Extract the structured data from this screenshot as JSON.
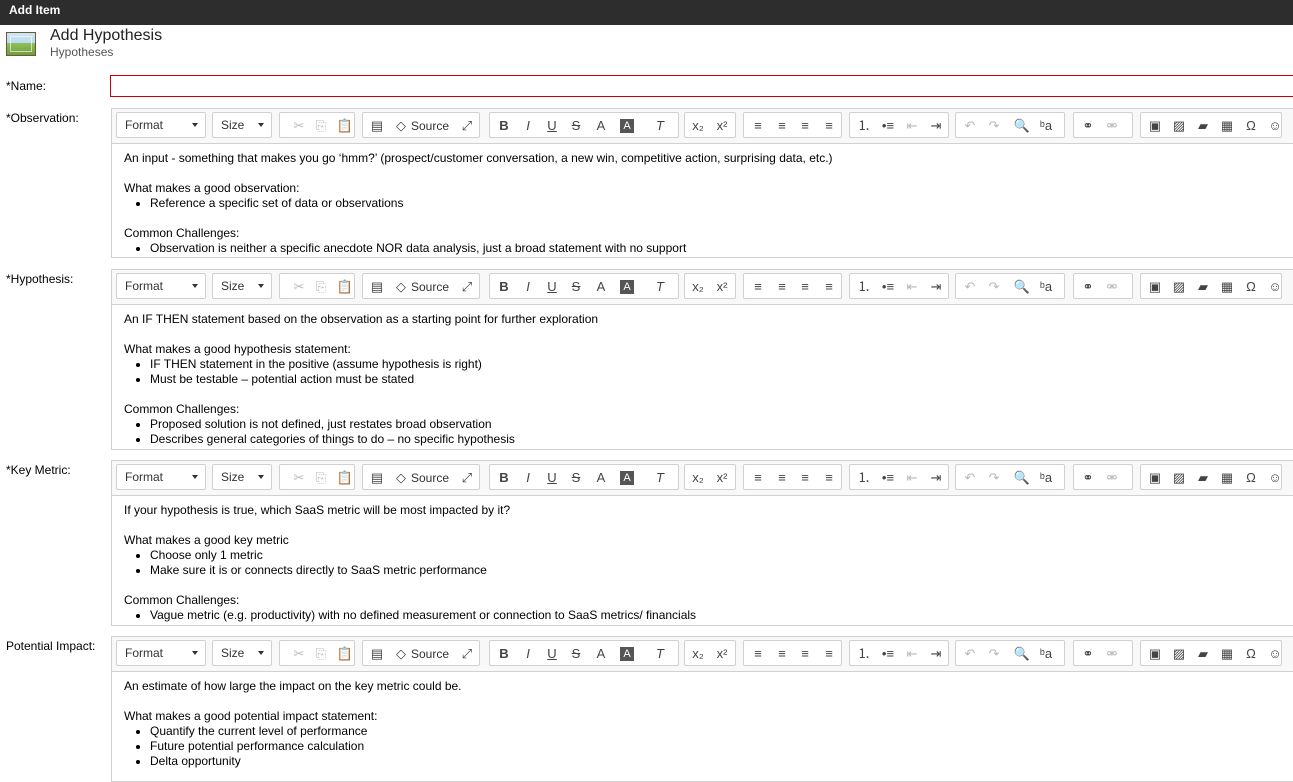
{
  "window": {
    "title": "Add Item"
  },
  "header": {
    "title": "Add Hypothesis",
    "subtitle": "Hypotheses",
    "icon": "image-icon"
  },
  "name_field": {
    "label": "*Name:",
    "value": ""
  },
  "toolbar": {
    "format": "Format",
    "size": "Size",
    "source": "Source",
    "icons": {
      "cut": "✂",
      "copy": "⎘",
      "paste": "📋",
      "document": "▤",
      "source": "◇",
      "maximize": "⤢",
      "bold": "B",
      "italic": "I",
      "underline": "U",
      "strike": "S",
      "text_color": "A",
      "bg_color": "A",
      "remove_format": "T",
      "subscript": "x₂",
      "superscript": "x²",
      "align_left": "≡",
      "align_center": "≡",
      "align_right": "≡",
      "justify": "≡",
      "numbered_list": "⒈",
      "bulleted_list": "•≡",
      "outdent": "⇤",
      "indent": "⇥",
      "undo": "↶",
      "redo": "↷",
      "find": "🔍",
      "replace": "ᵇa",
      "link": "⚭",
      "unlink": "⚮",
      "image_insert": "▣",
      "image_manager": "▨",
      "folder": "▰",
      "table": "▦",
      "omega": "Ω",
      "accessibility": "☺"
    }
  },
  "fields": [
    {
      "label": "*Observation:",
      "intro": "An input - something that makes you go ‘hmm?’  (prospect/customer conversation, a new win, competitive action, surprising data, etc.)",
      "good_heading": "What makes a good observation:",
      "good_items": [
        "Reference a specific set of data or observations"
      ],
      "challenges_heading": "Common Challenges:",
      "challenge_items": [
        "Observation is neither a specific anecdote NOR data analysis, just a broad statement with no support"
      ]
    },
    {
      "label": "*Hypothesis:",
      "intro": "An IF THEN statement based on the observation as a starting point for further exploration",
      "good_heading": "What makes a good hypothesis statement:",
      "good_items": [
        "IF THEN statement in the positive (assume hypothesis is right)",
        "Must be testable – potential action must be stated"
      ],
      "challenges_heading": "Common Challenges:",
      "challenge_items": [
        "Proposed solution is not defined, just restates broad observation",
        "Describes general categories of things to do – no specific hypothesis"
      ]
    },
    {
      "label": "*Key Metric:",
      "intro": "If your hypothesis is true, which SaaS metric will be most impacted by it?",
      "good_heading": "What makes a good key metric",
      "good_items": [
        "Choose only 1 metric",
        "Make sure it is or  connects directly to SaaS metric performance"
      ],
      "challenges_heading": "Common Challenges:",
      "challenge_items": [
        "Vague metric (e.g. productivity) with no defined measurement or connection to SaaS metrics/ financials"
      ]
    },
    {
      "label": "Potential Impact:",
      "intro": "An estimate of how large the impact on the key metric could be.",
      "good_heading": "What makes a good potential impact statement:",
      "good_items": [
        "Quantify the current level of performance",
        "Future potential performance calculation",
        "Delta opportunity"
      ]
    }
  ]
}
